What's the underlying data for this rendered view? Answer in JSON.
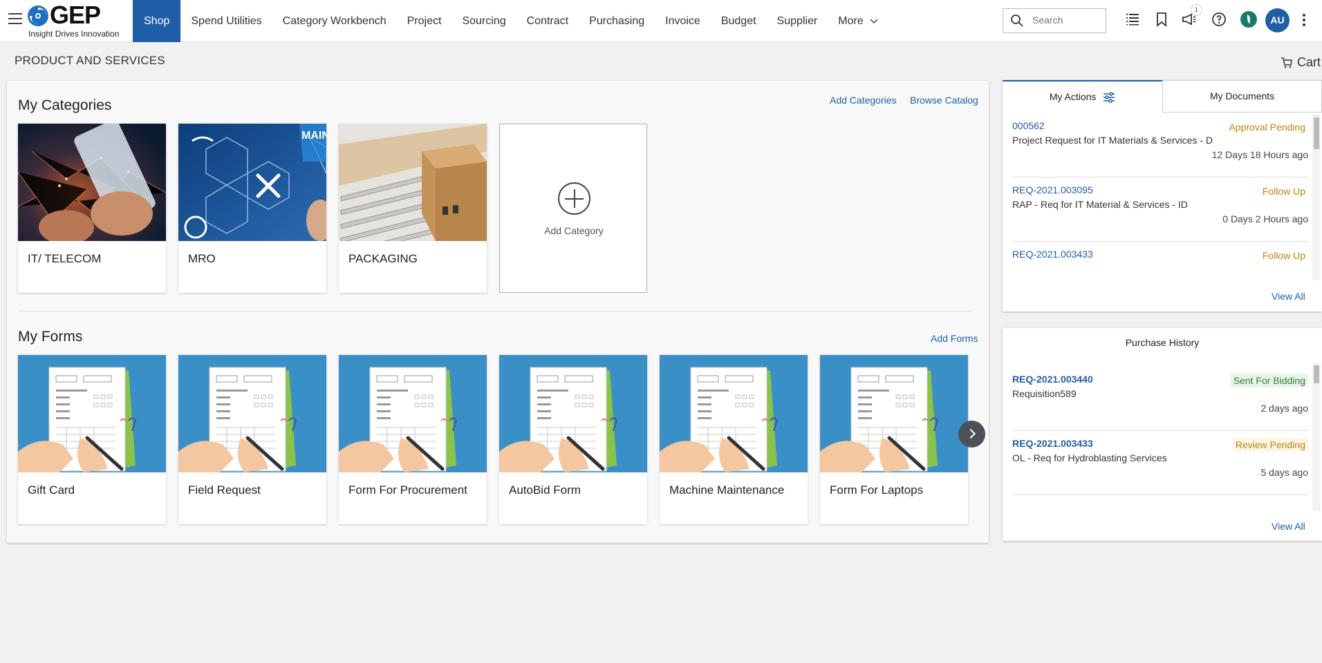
{
  "header": {
    "logo_text": "GEP",
    "logo_tagline": "Insight Drives Innovation",
    "nav": [
      "Shop",
      "Spend Utilities",
      "Category Workbench",
      "Project",
      "Sourcing",
      "Contract",
      "Purchasing",
      "Invoice",
      "Budget",
      "Supplier",
      "More"
    ],
    "active_nav": "Shop",
    "search_placeholder": "Search",
    "notification_count": "1",
    "avatar_initials": "AU"
  },
  "page": {
    "title": "PRODUCT AND SERVICES",
    "cart_label": "Cart"
  },
  "categories": {
    "heading": "My Categories",
    "add_link": "Add Categories",
    "browse_link": "Browse Catalog",
    "items": [
      "IT/ TELECOM",
      "MRO",
      "PACKAGING"
    ],
    "add_card_label": "Add Category",
    "mro_banner": "MAIN &"
  },
  "forms": {
    "heading": "My Forms",
    "add_link": "Add Forms",
    "items": [
      "Gift Card",
      "Field Request",
      "Form For Procurement",
      "AutoBid Form",
      "Machine Maintenance",
      "Form For Laptops"
    ]
  },
  "actions_panel": {
    "tab_actions": "My Actions",
    "tab_documents": "My Documents",
    "rows": [
      {
        "id": "000562",
        "status": "Approval Pending",
        "status_color": "#b8860b",
        "desc": "Project Request for IT Materials & Services - D",
        "time": "12 Days 18 Hours ago"
      },
      {
        "id": "REQ-2021.003095",
        "status": "Follow Up",
        "status_color": "#b8860b",
        "desc": "RAP - Req for IT Material & Services - ID",
        "time": "0 Days 2 Hours ago"
      },
      {
        "id": "REQ-2021.003433",
        "status": "Follow Up",
        "status_color": "#b8860b",
        "desc": "",
        "time": ""
      }
    ],
    "view_all": "View All"
  },
  "purchase_history": {
    "title": "Purchase History",
    "rows": [
      {
        "id": "REQ-2021.003440",
        "status": "Sent For Bidding",
        "status_color": "#2e7d32",
        "status_bg": "#eaf5ea",
        "desc": "Requisition589",
        "time": "2 days ago"
      },
      {
        "id": "REQ-2021.003433",
        "status": "Review Pending",
        "status_color": "#b8860b",
        "status_bg": "#fdf5e6",
        "desc": "OL - Req for Hydroblasting Services",
        "time": "5 days ago"
      }
    ],
    "view_all": "View All"
  }
}
